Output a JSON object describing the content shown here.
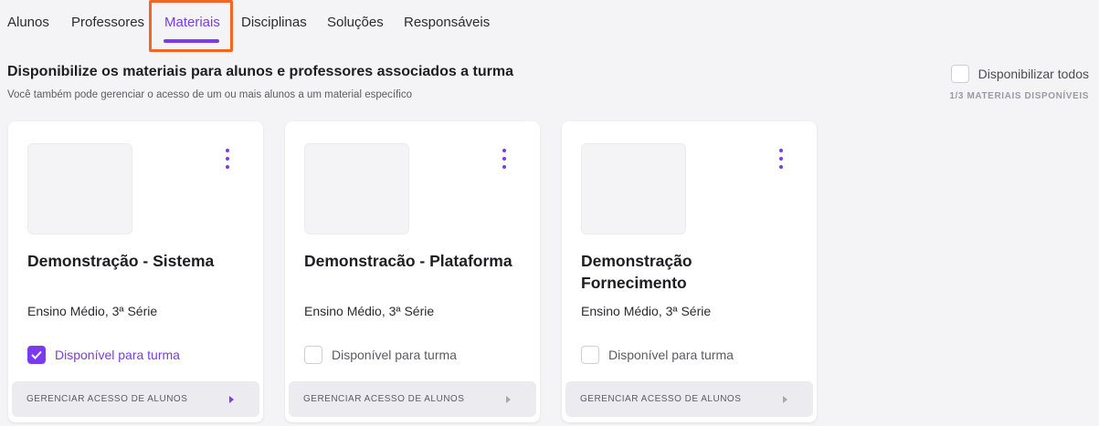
{
  "tabs": [
    {
      "label": "Alunos"
    },
    {
      "label": "Professores"
    },
    {
      "label": "Materiais"
    },
    {
      "label": "Disciplinas"
    },
    {
      "label": "Soluções"
    },
    {
      "label": "Responsáveis"
    }
  ],
  "active_tab": "Materiais",
  "header": {
    "title": "Disponibilize os materiais para alunos e professores associados a turma",
    "subtitle": "Você também pode gerenciar o acesso de um ou mais alunos a um material específico"
  },
  "toggle_all": {
    "label": "Disponibilizar todos",
    "checked": false
  },
  "count_text": "1/3 MATERIAIS DISPONÍVEIS",
  "cards": [
    {
      "title": "Demonstração - Sistema",
      "meta": "Ensino Médio, 3ª Série",
      "available_label": "Disponível para turma",
      "available": true,
      "manage_label": "GERENCIAR ACESSO DE ALUNOS"
    },
    {
      "title": "Demonstracão - Plataforma",
      "meta": "Ensino Médio, 3ª Série",
      "available_label": "Disponível para turma",
      "available": false,
      "manage_label": "GERENCIAR ACESSO DE ALUNOS"
    },
    {
      "title": "Demonstração Fornecimento",
      "meta": "Ensino Médio, 3ª Série",
      "available_label": "Disponível para turma",
      "available": false,
      "manage_label": "GERENCIAR ACESSO DE ALUNOS"
    }
  ],
  "colors": {
    "accent": "#7c3aed",
    "highlight": "#f26522"
  }
}
